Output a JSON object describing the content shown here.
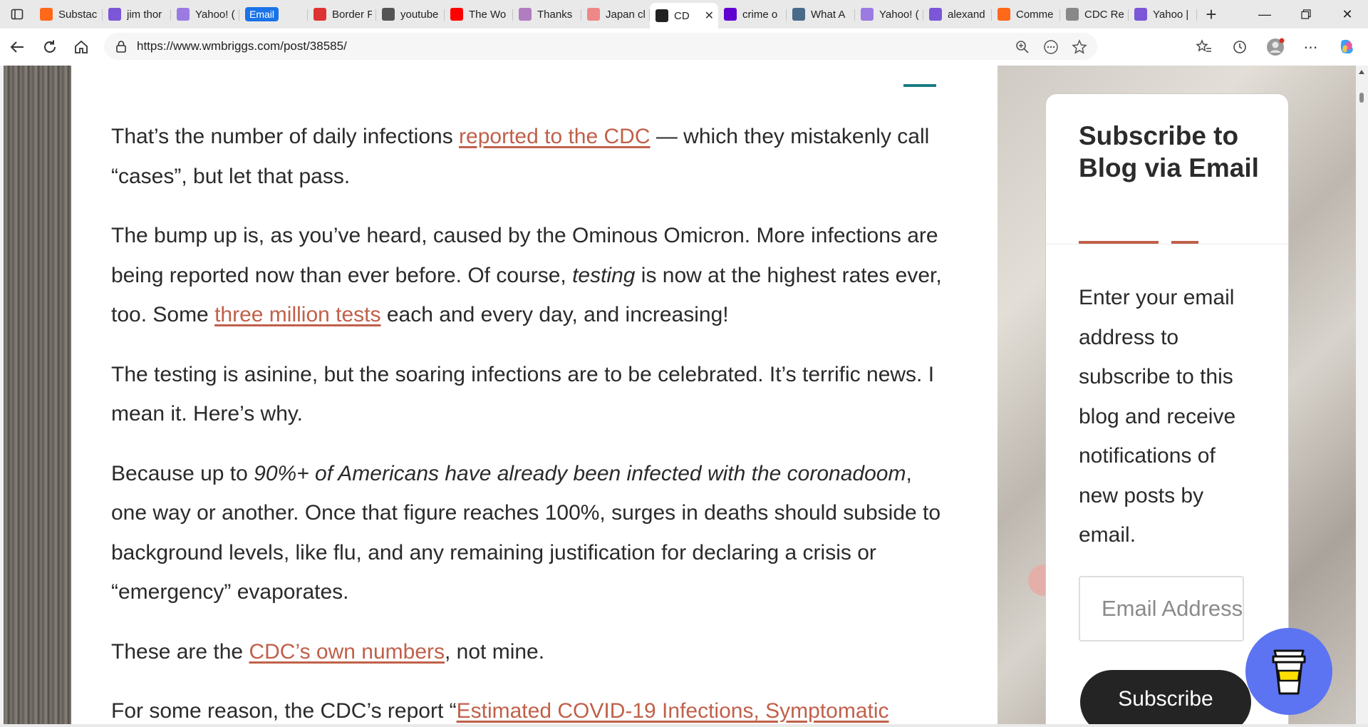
{
  "browser": {
    "tabs": [
      {
        "title": "Substac",
        "icon": "substack-icon",
        "color": "#ff6719"
      },
      {
        "title": "jim thor",
        "icon": "yahoo-icon",
        "color": "#7b56d6"
      },
      {
        "title": "Yahoo! (",
        "icon": "yahoo-answers-icon",
        "color": "#9b7be2"
      },
      {
        "title": "Email",
        "icon": "email-badge",
        "color": "#1a73e8"
      },
      {
        "title": "Border F",
        "icon": "ap-icon",
        "color": "#d33"
      },
      {
        "title": "youtube",
        "icon": "search-icon",
        "color": "#555"
      },
      {
        "title": "The Wo",
        "icon": "youtube-icon",
        "color": "#ff0000"
      },
      {
        "title": "Thanks",
        "icon": "bird-icon",
        "color": "#b07dc0"
      },
      {
        "title": "Japan cl",
        "icon": "youtube-icon",
        "color": "#e88"
      },
      {
        "title": "CD",
        "icon": "site-icon",
        "color": "#222",
        "active": true
      },
      {
        "title": "crime o",
        "icon": "yahoo-icon",
        "color": "#6001d2"
      },
      {
        "title": "What A",
        "icon": "cube-icon",
        "color": "#4a6a8a"
      },
      {
        "title": "Yahoo! (",
        "icon": "yahoo-answers-icon",
        "color": "#9b7be2"
      },
      {
        "title": "alexand",
        "icon": "yahoo-icon",
        "color": "#7b56d6"
      },
      {
        "title": "Comme",
        "icon": "substack-icon",
        "color": "#ff6719"
      },
      {
        "title": "CDC Re",
        "icon": "fp-icon",
        "color": "#888"
      },
      {
        "title": "Yahoo |",
        "icon": "yahoo-icon",
        "color": "#7b56d6"
      }
    ],
    "url": "https://www.wmbriggs.com/post/38585/"
  },
  "article": {
    "p1": {
      "t1": "That’s the number of daily infections ",
      "link1": "reported to the CDC",
      "t2": " — which they mistakenly call “cases”, but let that pass."
    },
    "p2": {
      "t1": "The bump up is, as you’ve heard, caused by the Ominous Omicron. More infections are being reported now than ever before. Of course, ",
      "em1": "testing",
      "t2": " is now at the highest rates ever, too. Some ",
      "link1": "three million tests",
      "t3": " each and every day, and increasing!"
    },
    "p3": {
      "t1": "The testing is asinine, but the soaring infections are to be celebrated. It’s terrific news. I mean it. Here’s why."
    },
    "p4": {
      "t1": "Because up to ",
      "em1": "90%+ of Americans have already been infected with the coronadoom",
      "t2": ", one way or another. Once that figure reaches 100%, surges in deaths should subside to background levels, like flu, and any remaining justification for declaring a crisis or “emergency” evaporates."
    },
    "p5": {
      "t1": "These are the ",
      "link1": "CDC’s own numbers",
      "t2": ", not mine."
    },
    "p6": {
      "t1": "For some reason, the CDC’s report “",
      "link1": "Estimated COVID-19 Infections, Symptomatic"
    }
  },
  "sidebar": {
    "title": "Subscribe to Blog via Email",
    "description": "Enter your email address to subscribe to this blog and receive notifications of new posts by email.",
    "email_placeholder": "Email Address",
    "subscribe_label": "Subscribe"
  },
  "colors": {
    "link": "#c0604a",
    "accent_teal": "#1c7c84",
    "coffee_button": "#5c73f2"
  }
}
